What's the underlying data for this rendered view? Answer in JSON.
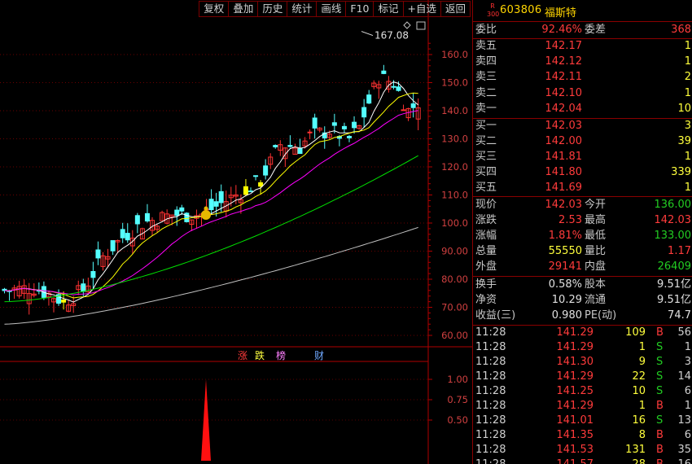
{
  "toolbar": {
    "buttons": [
      "复权",
      "叠加",
      "历史",
      "统计",
      "画线",
      "F10",
      "标记",
      "+自选",
      "返回"
    ]
  },
  "chart": {
    "high_label": "167.08",
    "price_ticks": [
      "160.0",
      "150.0",
      "140.0",
      "130.0",
      "120.0",
      "110.0",
      "100.0",
      "90.00",
      "80.00",
      "70.00",
      "60.00"
    ],
    "indicator_ticks": [
      "1.00",
      "0.75",
      "0.50"
    ],
    "badges": {
      "rise": "涨",
      "fall": "跌",
      "list": "榜",
      "fin": "财"
    },
    "colors": {
      "up": "#ff3232",
      "down": "#54ffff",
      "highlight": "#ffff00",
      "ma5": "#ffffff",
      "ma10": "#ffff00",
      "ma20": "#ff00ff",
      "ma60": "#00e000",
      "ma120": "#c0c0c0",
      "axis": "#b00000"
    }
  },
  "stock": {
    "market_badge": "R\n300",
    "code": "603806",
    "name": "福斯特"
  },
  "quote": {
    "commit_ratio_label": "委比",
    "commit_ratio": "92.46%",
    "commit_diff_label": "委差",
    "commit_diff": "368",
    "asks": [
      {
        "label": "卖五",
        "price": "142.17",
        "vol": "1"
      },
      {
        "label": "卖四",
        "price": "142.12",
        "vol": "1"
      },
      {
        "label": "卖三",
        "price": "142.11",
        "vol": "2"
      },
      {
        "label": "卖二",
        "price": "142.10",
        "vol": "1"
      },
      {
        "label": "卖一",
        "price": "142.04",
        "vol": "10"
      }
    ],
    "bids": [
      {
        "label": "买一",
        "price": "142.03",
        "vol": "3"
      },
      {
        "label": "买二",
        "price": "142.00",
        "vol": "39"
      },
      {
        "label": "买三",
        "price": "141.81",
        "vol": "1"
      },
      {
        "label": "买四",
        "price": "141.80",
        "vol": "339"
      },
      {
        "label": "买五",
        "price": "141.69",
        "vol": "1"
      }
    ],
    "stats": [
      {
        "l1": "现价",
        "v1": "142.03",
        "c1": "red",
        "l2": "今开",
        "v2": "136.00",
        "c2": "green"
      },
      {
        "l1": "涨跌",
        "v1": "2.53",
        "c1": "red",
        "l2": "最高",
        "v2": "142.03",
        "c2": "red"
      },
      {
        "l1": "涨幅",
        "v1": "1.81%",
        "c1": "red",
        "l2": "最低",
        "v2": "133.00",
        "c2": "green"
      },
      {
        "l1": "总量",
        "v1": "55550",
        "c1": "yellow",
        "l2": "量比",
        "v2": "1.17",
        "c2": "red"
      },
      {
        "l1": "外盘",
        "v1": "29141",
        "c1": "red",
        "l2": "内盘",
        "v2": "26409",
        "c2": "green"
      }
    ],
    "fundamentals": [
      {
        "l1": "换手",
        "v1": "0.58%",
        "l2": "股本",
        "v2": "9.51亿"
      },
      {
        "l1": "净资",
        "v1": "10.29",
        "l2": "流通",
        "v2": "9.51亿"
      },
      {
        "l1": "收益(三)",
        "v1": "0.980",
        "l2": "PE(动)",
        "v2": "74.7"
      }
    ]
  },
  "ticks": [
    {
      "time": "11:28",
      "price": "141.29",
      "vol": "109",
      "side": "B",
      "num": "56"
    },
    {
      "time": "11:28",
      "price": "141.29",
      "vol": "1",
      "side": "S",
      "num": "1"
    },
    {
      "time": "11:28",
      "price": "141.30",
      "vol": "9",
      "side": "S",
      "num": "3"
    },
    {
      "time": "11:28",
      "price": "141.29",
      "vol": "22",
      "side": "S",
      "num": "14"
    },
    {
      "time": "11:28",
      "price": "141.25",
      "vol": "10",
      "side": "S",
      "num": "6"
    },
    {
      "time": "11:28",
      "price": "141.29",
      "vol": "1",
      "side": "B",
      "num": "1"
    },
    {
      "time": "11:28",
      "price": "141.01",
      "vol": "16",
      "side": "S",
      "num": "13"
    },
    {
      "time": "11:28",
      "price": "141.35",
      "vol": "8",
      "side": "B",
      "num": "6"
    },
    {
      "time": "11:28",
      "price": "141.53",
      "vol": "131",
      "side": "B",
      "num": "35"
    },
    {
      "time": "11:28",
      "price": "141.57",
      "vol": "28",
      "side": "B",
      "num": "16"
    }
  ]
}
